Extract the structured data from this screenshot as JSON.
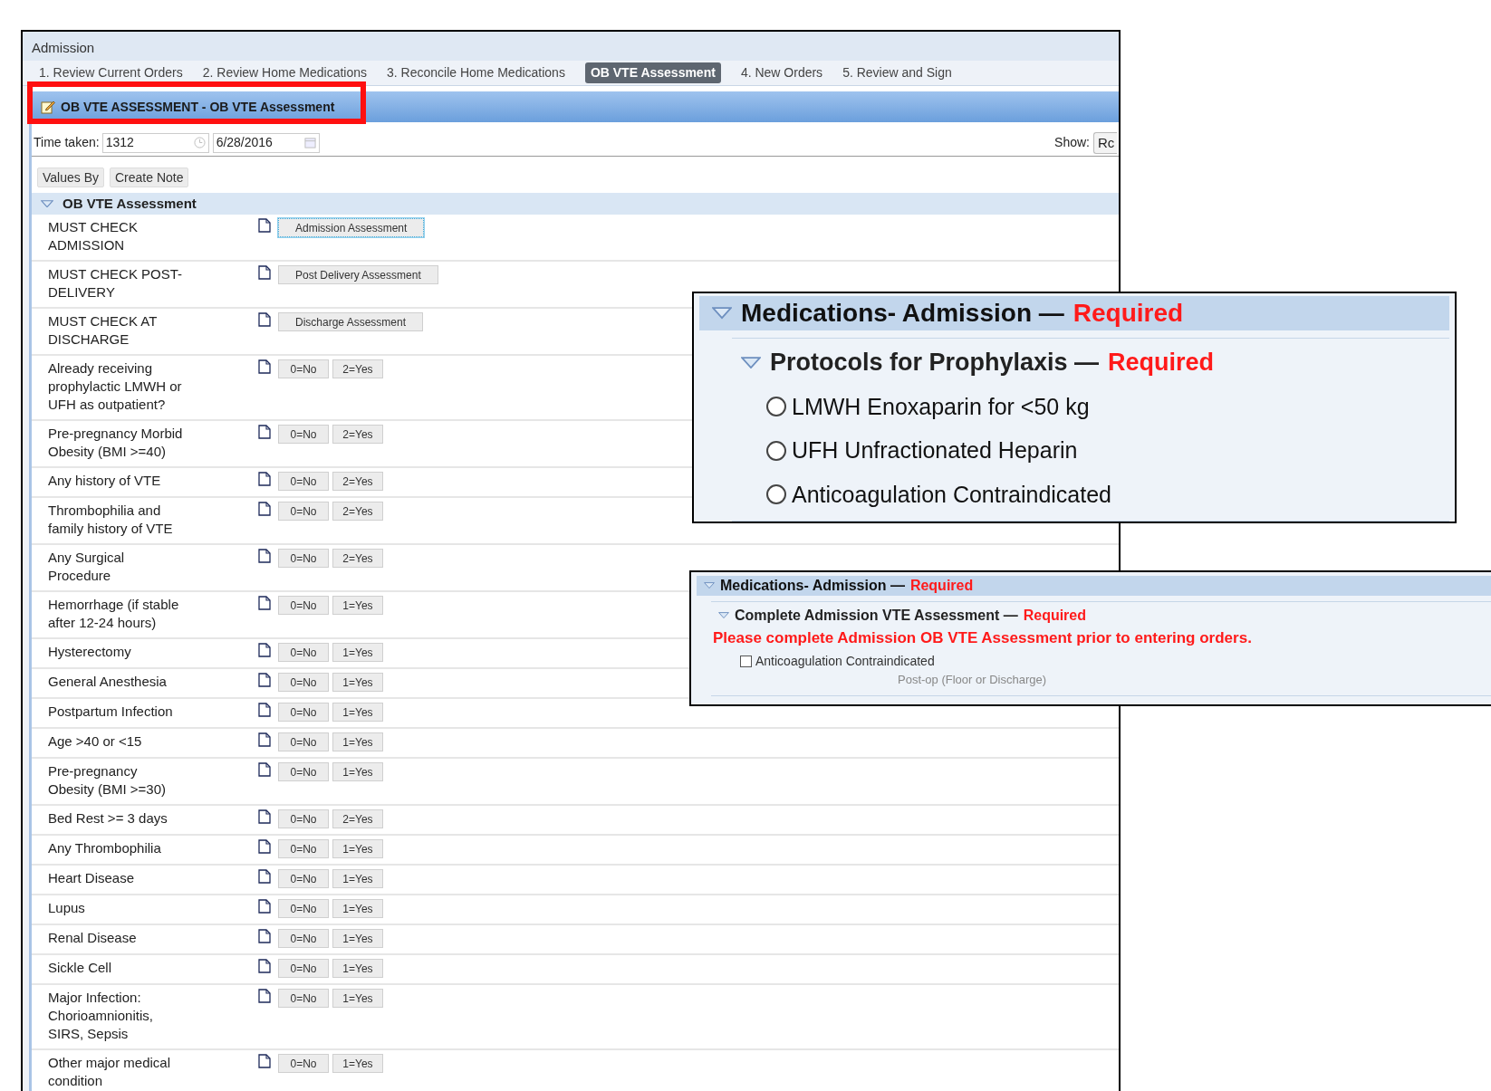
{
  "window": {
    "title": "Admission"
  },
  "tabs": [
    {
      "label": "1. Review Current Orders",
      "selected": false
    },
    {
      "label": "2. Review Home Medications",
      "selected": false
    },
    {
      "label": "3. Reconcile Home Medications",
      "selected": false
    },
    {
      "label": "OB VTE Assessment",
      "selected": true
    },
    {
      "label": "4. New Orders",
      "selected": false
    },
    {
      "label": "5. Review and Sign",
      "selected": false
    }
  ],
  "form_header": {
    "title": "OB VTE ASSESSMENT - OB VTE Assessment"
  },
  "time_row": {
    "label": "Time taken:",
    "time": "1312",
    "date": "6/28/2016",
    "show_label": "Show:",
    "show_value": "Rc"
  },
  "toolbar": [
    "Values By",
    "Create Note"
  ],
  "section": {
    "title": "OB VTE Assessment",
    "expanded": true
  },
  "rows": [
    {
      "label": "MUST CHECK ADMISSION",
      "options": [
        {
          "label": "Admission Assessment",
          "focused": true
        }
      ]
    },
    {
      "label": "MUST CHECK POST-DELIVERY",
      "options": [
        {
          "label": "Post Delivery Assessment",
          "focused": false
        }
      ]
    },
    {
      "label": "MUST CHECK AT DISCHARGE",
      "options": [
        {
          "label": "Discharge Assessment",
          "focused": false
        }
      ]
    },
    {
      "label": "Already receiving prophylactic LMWH or UFH as outpatient?",
      "options": [
        {
          "label": "0=No",
          "focused": false
        },
        {
          "label": "2=Yes",
          "focused": false
        }
      ]
    },
    {
      "label": "Pre-pregnancy Morbid Obesity (BMI >=40)",
      "options": [
        {
          "label": "0=No",
          "focused": false
        },
        {
          "label": "2=Yes",
          "focused": false
        }
      ]
    },
    {
      "label": "Any history of VTE",
      "options": [
        {
          "label": "0=No",
          "focused": false
        },
        {
          "label": "2=Yes",
          "focused": false
        }
      ]
    },
    {
      "label": "Thrombophilia and family history of VTE",
      "options": [
        {
          "label": "0=No",
          "focused": false
        },
        {
          "label": "2=Yes",
          "focused": false
        }
      ]
    },
    {
      "label": "Any Surgical Procedure",
      "options": [
        {
          "label": "0=No",
          "focused": false
        },
        {
          "label": "2=Yes",
          "focused": false
        }
      ]
    },
    {
      "label": "Hemorrhage (if stable after 12-24 hours)",
      "options": [
        {
          "label": "0=No",
          "focused": false
        },
        {
          "label": "1=Yes",
          "focused": false
        }
      ]
    },
    {
      "label": "Hysterectomy",
      "options": [
        {
          "label": "0=No",
          "focused": false
        },
        {
          "label": "1=Yes",
          "focused": false
        }
      ]
    },
    {
      "label": "General Anesthesia",
      "options": [
        {
          "label": "0=No",
          "focused": false
        },
        {
          "label": "1=Yes",
          "focused": false
        }
      ]
    },
    {
      "label": "Postpartum Infection",
      "options": [
        {
          "label": "0=No",
          "focused": false
        },
        {
          "label": "1=Yes",
          "focused": false
        }
      ]
    },
    {
      "label": "Age >40 or <15",
      "options": [
        {
          "label": "0=No",
          "focused": false
        },
        {
          "label": "1=Yes",
          "focused": false
        }
      ]
    },
    {
      "label": "Pre-pregnancy Obesity (BMI >=30)",
      "options": [
        {
          "label": "0=No",
          "focused": false
        },
        {
          "label": "1=Yes",
          "focused": false
        }
      ]
    },
    {
      "label": "Bed Rest >= 3 days",
      "options": [
        {
          "label": "0=No",
          "focused": false
        },
        {
          "label": "2=Yes",
          "focused": false
        }
      ]
    },
    {
      "label": "Any Thrombophilia",
      "options": [
        {
          "label": "0=No",
          "focused": false
        },
        {
          "label": "1=Yes",
          "focused": false
        }
      ]
    },
    {
      "label": "Heart Disease",
      "options": [
        {
          "label": "0=No",
          "focused": false
        },
        {
          "label": "1=Yes",
          "focused": false
        }
      ]
    },
    {
      "label": "Lupus",
      "options": [
        {
          "label": "0=No",
          "focused": false
        },
        {
          "label": "1=Yes",
          "focused": false
        }
      ]
    },
    {
      "label": "Renal Disease",
      "options": [
        {
          "label": "0=No",
          "focused": false
        },
        {
          "label": "1=Yes",
          "focused": false
        }
      ]
    },
    {
      "label": "Sickle Cell",
      "options": [
        {
          "label": "0=No",
          "focused": false
        },
        {
          "label": "1=Yes",
          "focused": false
        }
      ]
    },
    {
      "label": "Major Infection: Chorioamnionitis, SIRS, Sepsis",
      "options": [
        {
          "label": "0=No",
          "focused": false
        },
        {
          "label": "1=Yes",
          "focused": false
        }
      ]
    },
    {
      "label": "Other major medical condition",
      "options": [
        {
          "label": "0=No",
          "focused": false
        },
        {
          "label": "1=Yes",
          "focused": false
        }
      ]
    }
  ],
  "inset_protocols": {
    "title": "Medications- Admission —",
    "required": "Required",
    "group": {
      "title": "Protocols for Prophylaxis —",
      "required": "Required"
    },
    "options": [
      {
        "label": "LMWH Enoxaparin for <50 kg",
        "selected": false
      },
      {
        "label": "UFH Unfractionated Heparin",
        "selected": false
      },
      {
        "label": "Anticoagulation Contraindicated",
        "selected": false
      }
    ]
  },
  "inset_warning": {
    "title": "Medications- Admission —",
    "required": "Required",
    "group": {
      "title": "Complete Admission VTE Assessment —",
      "required": "Required"
    },
    "message": "Please complete Admission OB VTE Assessment prior to entering orders.",
    "checkbox": {
      "label": "Anticoagulation Contraindicated",
      "checked": false
    },
    "note": "Post-op (Floor or Discharge)"
  }
}
